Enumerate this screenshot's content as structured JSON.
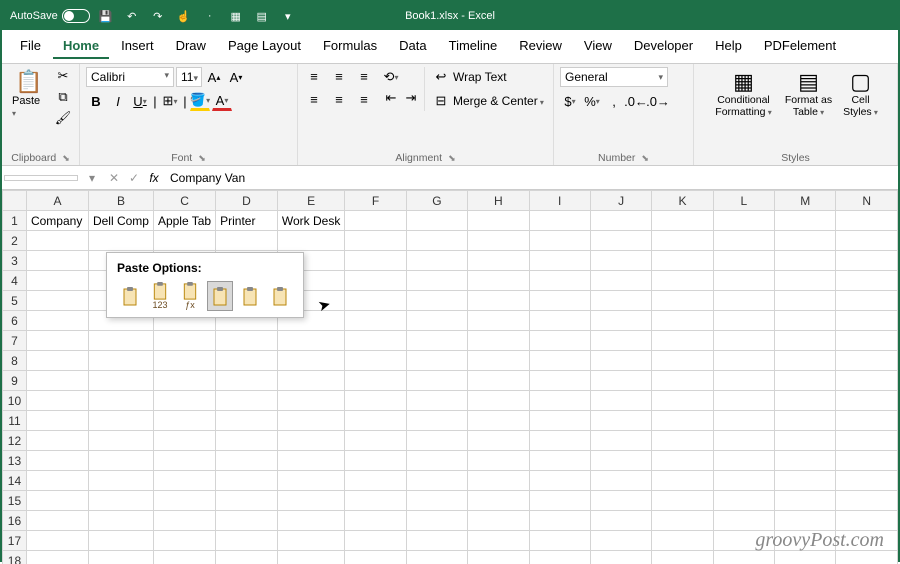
{
  "titlebar": {
    "autosave": "AutoSave",
    "autosave_state": "Off",
    "title": "Book1.xlsx  -  Excel"
  },
  "tabs": [
    "File",
    "Home",
    "Insert",
    "Draw",
    "Page Layout",
    "Formulas",
    "Data",
    "Timeline",
    "Review",
    "View",
    "Developer",
    "Help",
    "PDFelement"
  ],
  "active_tab": "Home",
  "clipboard": {
    "paste": "Paste",
    "label": "Clipboard"
  },
  "font": {
    "name": "Calibri",
    "size": "11",
    "label": "Font"
  },
  "alignment": {
    "wrap": "Wrap Text",
    "merge": "Merge & Center",
    "label": "Alignment"
  },
  "number": {
    "format": "General",
    "label": "Number"
  },
  "styles": {
    "cond": "Conditional Formatting",
    "table": "Format as Table",
    "cell": "Cell Styles",
    "label": "Styles"
  },
  "formula_bar": {
    "value": "Company Van"
  },
  "columns": [
    "A",
    "B",
    "C",
    "D",
    "E",
    "F",
    "G",
    "H",
    "I",
    "J",
    "K",
    "L",
    "M",
    "N"
  ],
  "row_count": 18,
  "cells": {
    "A1": "Company",
    "B1": "Dell Comp",
    "C1": "Apple Tab",
    "D1": "Printer",
    "E1": "Work Desk"
  },
  "paste_popup": {
    "title": "Paste Options:",
    "options": [
      "paste-all",
      "paste-values",
      "paste-formulas",
      "paste-transpose",
      "paste-formatting",
      "paste-link"
    ],
    "opt_labels": [
      "",
      "123",
      "ƒx",
      "",
      "",
      ""
    ]
  },
  "watermark": "groovyPost.com"
}
